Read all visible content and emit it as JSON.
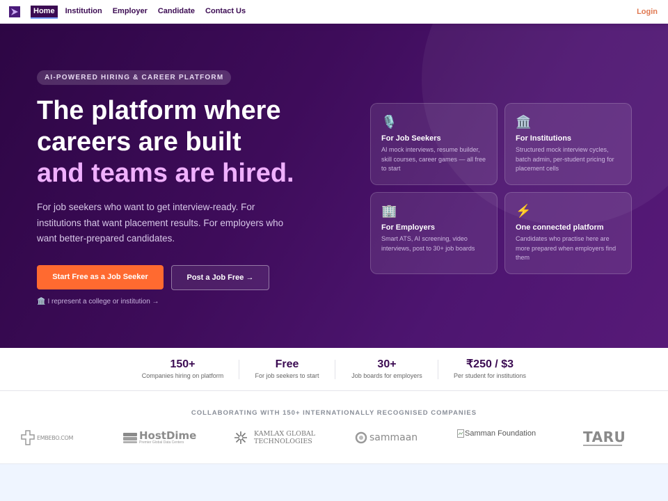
{
  "nav": {
    "links": [
      "Home",
      "Institution",
      "Employer",
      "Candidate",
      "Contact Us"
    ],
    "login": "Login"
  },
  "hero": {
    "badge": "AI-POWERED HIRING & CAREER PLATFORM",
    "headline_1": "The platform where",
    "headline_2": "careers are built",
    "headline_3": "and teams are hired.",
    "subtitle": "For job seekers who want to get interview-ready. For institutions that want placement results. For employers who want better-prepared candidates.",
    "primary_cta": "Start Free as a Job Seeker",
    "secondary_cta": "Post a Job Free →",
    "institution_link": "I represent a college or institution →"
  },
  "cards": [
    {
      "icon": "microphone-icon",
      "glyph": "🎙️",
      "title": "For Job Seekers",
      "desc": "AI mock interviews, resume builder, skill courses, career games — all free to start"
    },
    {
      "icon": "institution-icon",
      "glyph": "🏛️",
      "title": "For Institutions",
      "desc": "Structured mock interview cycles, batch admin, per-student pricing for placement cells"
    },
    {
      "icon": "office-building-icon",
      "glyph": "🏢",
      "title": "For Employers",
      "desc": "Smart ATS, AI screening, video interviews, post to 30+ job boards"
    },
    {
      "icon": "lightning-icon",
      "glyph": "⚡",
      "title": "One connected platform",
      "desc": "Candidates who practise here are more prepared when employers find them"
    }
  ],
  "stats": [
    {
      "value": "150+",
      "label": "Companies hiring on platform"
    },
    {
      "value": "Free",
      "label": "For job seekers to start"
    },
    {
      "value": "30+",
      "label": "Job boards for employers"
    },
    {
      "value": "₹250 / $3",
      "label": "Per student for institutions"
    }
  ],
  "partners": {
    "title": "COLLABORATING WITH 150+ INTERNATIONALLY RECOGNISED COMPANIES",
    "logos": [
      "EMBEBO.COM",
      "HostDime",
      "Premier Global Data Centers",
      "KAMLAX GLOBAL",
      "TECHNOLOGIES",
      "sammaan",
      "Samman Foundation",
      "TARU"
    ]
  },
  "colors": {
    "brand_purple": "#3b0b52",
    "accent_orange": "#ff6a30",
    "accent_pink": "#f0b0ff",
    "login_orange": "#e07850"
  }
}
